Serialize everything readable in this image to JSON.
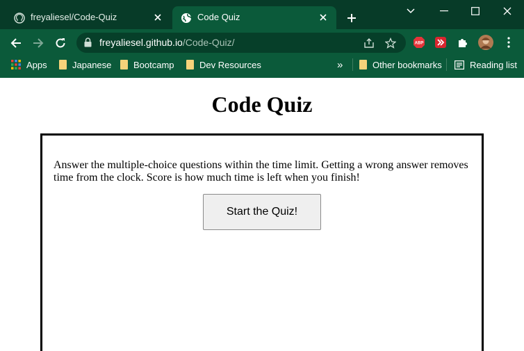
{
  "browser": {
    "tabs": [
      {
        "title": "freyaliesel/Code-Quiz",
        "favicon": "github-icon",
        "active": false
      },
      {
        "title": "Code Quiz",
        "favicon": "globe-icon",
        "active": true
      }
    ],
    "address": {
      "host": "freyaliesel.github.io",
      "path": "/Code-Quiz/"
    },
    "bookmarks": [
      {
        "label": "Apps",
        "icon": "apps-grid-icon"
      },
      {
        "label": "Japanese",
        "icon": "folder-icon"
      },
      {
        "label": "Bootcamp",
        "icon": "folder-icon"
      },
      {
        "label": "Dev Resources",
        "icon": "folder-icon"
      }
    ],
    "overflow_label": "»",
    "other_bookmarks": "Other bookmarks",
    "reading_list": "Reading list",
    "extensions": [
      {
        "name": "adblock-plus-icon",
        "label": "ABP"
      }
    ],
    "colors": {
      "tabstrip": "#073b28",
      "toolbar": "#0b5a3a",
      "omnibox": "#063f29"
    }
  },
  "page": {
    "title": "Code Quiz",
    "intro": "Answer the multiple-choice questions within the time limit. Getting a wrong answer removes time from the clock. Score is how much time is left when you finish!",
    "start_label": "Start the Quiz!"
  }
}
